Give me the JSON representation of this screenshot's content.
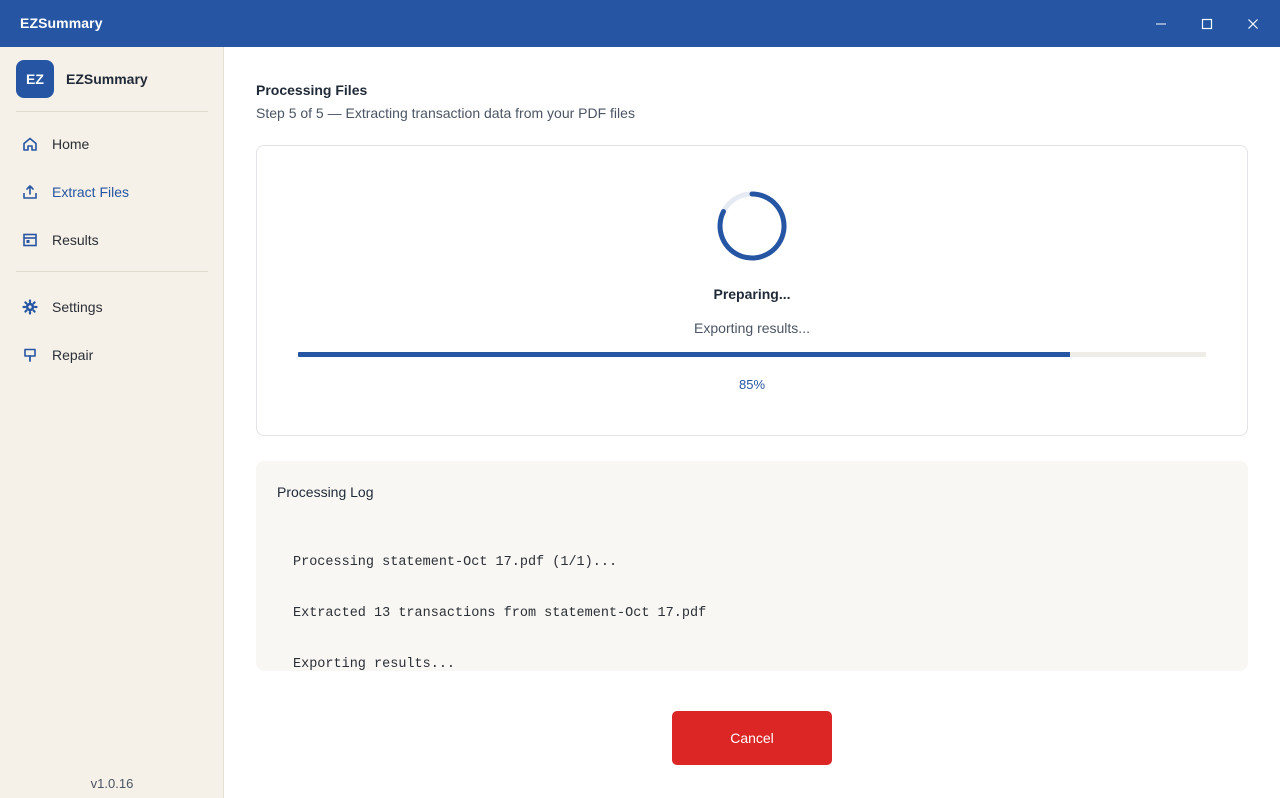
{
  "window": {
    "title": "EZSummary"
  },
  "sidebar": {
    "brand_badge": "EZ",
    "brand_name": "EZSummary",
    "items": [
      {
        "label": "Home",
        "icon": "home-icon"
      },
      {
        "label": "Extract Files",
        "icon": "upload-icon",
        "active": true
      },
      {
        "label": "Results",
        "icon": "results-icon"
      },
      {
        "label": "Settings",
        "icon": "gear-icon"
      },
      {
        "label": "Repair",
        "icon": "repair-icon"
      }
    ],
    "version": "v1.0.16"
  },
  "main": {
    "title": "Processing Files",
    "subtitle": "Step 5 of 5 — Extracting transaction data from your PDF files",
    "status_title": "Preparing...",
    "status_sub": "Exporting results...",
    "progress_percent": 85,
    "progress_label": "85%",
    "log": {
      "title": "Processing Log",
      "lines": [
        "Processing statement-Oct 17.pdf (1/1)...",
        "Extracted 13 transactions from statement-Oct 17.pdf",
        "Exporting results..."
      ]
    },
    "cancel_label": "Cancel"
  },
  "colors": {
    "accent": "#2656a3",
    "danger": "#dc2626",
    "sidebar_bg": "#f5f0e8"
  }
}
